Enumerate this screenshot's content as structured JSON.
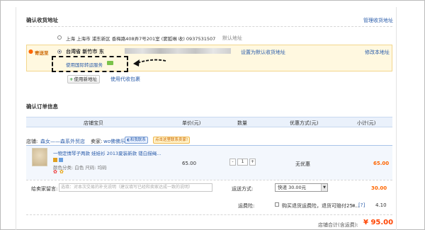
{
  "address_section": {
    "title": "确认收货地址",
    "manage_link": "管理收货地址",
    "addresses": [
      {
        "text": "上海 上海市 浦东新区 香梅路408弄7号201室 (窦狐琳 收) 0937531507",
        "action": "默认地址"
      },
      {
        "label": "寄送至",
        "text": "台湾省 新竹市 东",
        "action": "设置为默认收货地址",
        "edit": "修改本地址"
      }
    ],
    "forwarding_service": "使用国际转运服务",
    "new_address_button": "使用新地址",
    "agent_pickup_link": "使用代收包裹"
  },
  "order_section": {
    "title": "确认订单信息",
    "columns": [
      "店铺宝贝",
      "单价(元)",
      "数量",
      "优惠方式(元)",
      "小计(元)"
    ],
    "shop_prefix": "店铺:",
    "shop_name": "森女——森系外贸店",
    "seller_prefix": "卖家:",
    "seller_name": "wo佛佛乐",
    "chat_label": "和我联系",
    "contact_hint": "点击这里联系卖家!",
    "item": {
      "title_line1": "一物定情琴子两款 娃娃衫 2013夏装新款 镂白描绳...",
      "attributes": "颜色分类: 白色   尺码: 均码",
      "price": "65.00",
      "quantity": "1",
      "discount": "无优惠",
      "subtotal": "65.00"
    },
    "message_label": "给卖家留言:",
    "message_placeholder": "选填：对本次交易的补充说明（建议填写已经和卖家达成一致的说明）",
    "shipping_label": "运送方式:",
    "shipping_option": "快递 30.00元",
    "shipping_cost": "30.00",
    "insurance_label": "运费险:",
    "insurance_text": "购买退货运费险，退货可赔付25....",
    "insurance_help": "[?]",
    "insurance_price": "4.10",
    "total_label": "店铺合计(含运费):",
    "total_value": "¥ 95.00"
  },
  "colors": {
    "link": "#2a5caa",
    "accent": "#f40",
    "highlight_bg": "#fff8e0",
    "table_head_bg": "#eaf1fb"
  },
  "icons": [
    "location-pin-icon",
    "arrow-pointer-icon",
    "plus-icon",
    "chat-icon",
    "tag-icon",
    "flower-icon",
    "select-arrow-icon",
    "help-icon"
  ]
}
